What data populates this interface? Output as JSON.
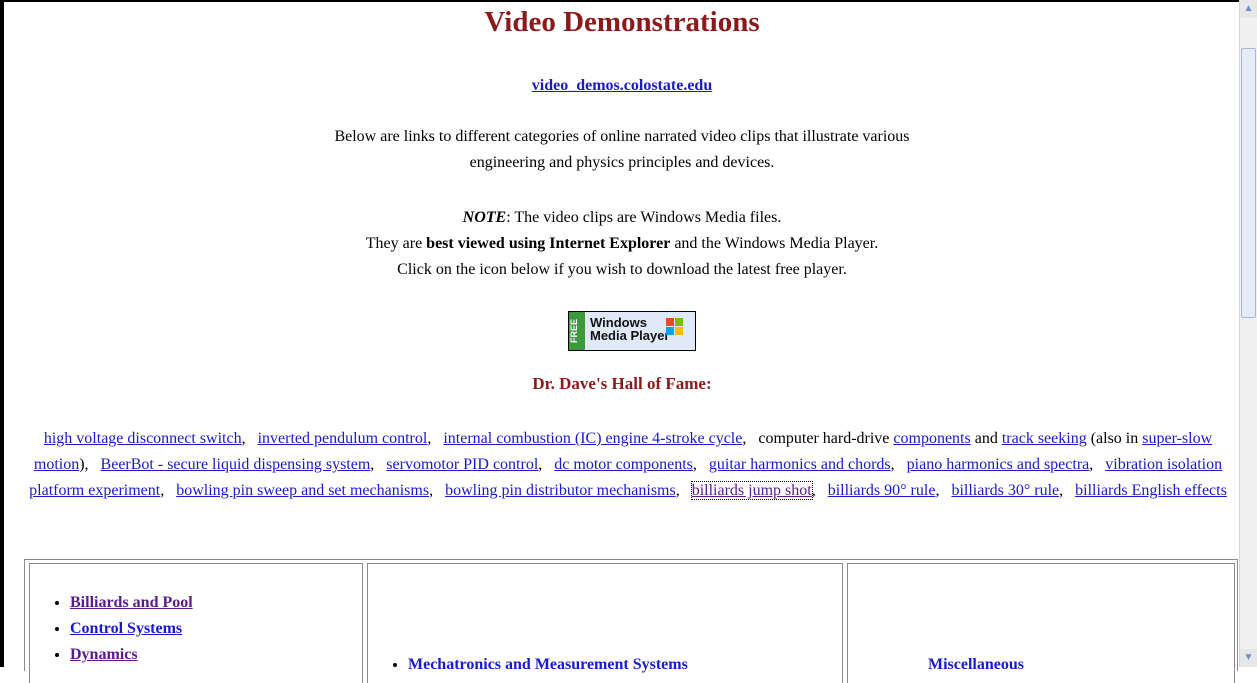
{
  "page": {
    "title": "Video Demonstrations",
    "site_link": "video_demos.colostate.edu",
    "intro_line1": "Below are links to different categories of online narrated video clips that illustrate various",
    "intro_line2": "engineering and physics principles and devices.",
    "note_label": "NOTE",
    "note_line1_rest": ": The video clips are Windows Media files.",
    "note_line2_a": "They are ",
    "note_line2_bold": "best viewed using Internet Explorer",
    "note_line2_b": " and the Windows Media Player.",
    "note_line3": "Click on the icon below if you wish to download the latest free player."
  },
  "wmp_badge": {
    "free": "FREE",
    "line1": "Windows",
    "line2": "Media Player"
  },
  "hall_of_fame": {
    "title": "Dr. Dave's Hall of Fame:",
    "link_high_voltage": "high voltage disconnect switch",
    "link_inverted_pendulum": "inverted pendulum control",
    "link_ic_engine": "internal combustion (IC) engine 4-stroke cycle",
    "text_hard_drive": "computer hard-drive ",
    "link_components": "components",
    "text_and": "and ",
    "link_track_seeking": "track seeking",
    "text_also_in": " (also in ",
    "link_super_slow": "super-slow motion",
    "text_close_paren": "),",
    "link_beerbot": "BeerBot - secure liquid dispensing system",
    "link_servomotor": "servomotor PID control",
    "link_dc_motor": "dc motor components",
    "link_guitar": "guitar harmonics and chords",
    "link_piano": "piano harmonics and spectra",
    "link_vibration": "vibration isolation platform experiment",
    "link_bowling_sweep": "bowling pin sweep and set mechanisms",
    "link_bowling_distributor": "bowling pin distributor mechanisms",
    "link_jump_shot": "billiards jump shot",
    "link_90_rule": "billiards 90° rule",
    "link_30_rule": "billiards 30° rule",
    "link_english": "billiards English effects"
  },
  "categories": {
    "col1": [
      "Billiards and Pool",
      "Control Systems",
      "Dynamics"
    ],
    "col2": [
      "Mechatronics and Measurement Systems"
    ],
    "col3_fragment": "Miscellaneous"
  },
  "colors": {
    "title": "#8b1a1a",
    "link": "#1a1acc",
    "visited_link": "#5a1a8b"
  }
}
